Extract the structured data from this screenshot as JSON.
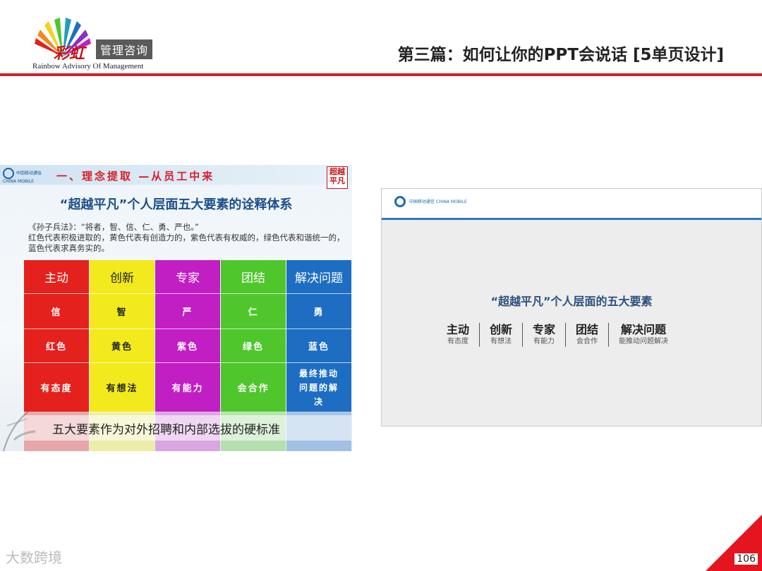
{
  "header": {
    "brand_cn": "彩虹",
    "brand_box": "管理咨询",
    "brand_en": "Rainbow  Advisory  Of  Management",
    "slide_title": "第三篇：如何让你的PPT会说话 [5单页设计]"
  },
  "left_slide": {
    "logo_text": "中国移动通信 CHINA MOBILE",
    "heading": "一、理念提取 —从员工中来",
    "stamp": "超越平凡",
    "title": "“超越平凡”个人层面五大要素的诠释体系",
    "quote": "《孙子兵法》：“将者，智、信、仁、勇、严也。”",
    "description": "红色代表积极进取的，黄色代表有创造力的，紫色代表有权威的，绿色代表和谐统一的，蓝色代表求真务实的。",
    "columns": [
      {
        "header": "主动",
        "virtue": "信",
        "color_name": "红色",
        "trait": "有态度",
        "color": "#e4211d"
      },
      {
        "header": "创新",
        "virtue": "智",
        "color_name": "黄色",
        "trait": "有想法",
        "color": "#f2ea1d"
      },
      {
        "header": "专家",
        "virtue": "严",
        "color_name": "紫色",
        "trait": "有能力",
        "color": "#c11ec4"
      },
      {
        "header": "团结",
        "virtue": "仁",
        "color_name": "绿色",
        "trait": "会合作",
        "color": "#4fc62c"
      },
      {
        "header": "解决问题",
        "virtue": "勇",
        "color_name": "蓝色",
        "trait": "最终推动问题的解决",
        "color": "#1d6ec2"
      }
    ],
    "banner": "五大要素作为对外招聘和内部选拔的硬标准"
  },
  "right_slide": {
    "logo_text": "中国移动通信 CHINA MOBILE",
    "title": "“超越平凡”个人层面的五大要素",
    "items": [
      {
        "name": "主动",
        "sub": "有态度"
      },
      {
        "name": "创新",
        "sub": "有想法"
      },
      {
        "name": "专家",
        "sub": "有能力"
      },
      {
        "name": "团结",
        "sub": "会合作"
      },
      {
        "name": "解决问题",
        "sub": "能推动问题解决"
      }
    ]
  },
  "footer": {
    "watermark": "大数跨境",
    "page_number": "106"
  },
  "colors": {
    "accent_red": "#d4202a",
    "accent_blue": "#2a7ac0"
  }
}
